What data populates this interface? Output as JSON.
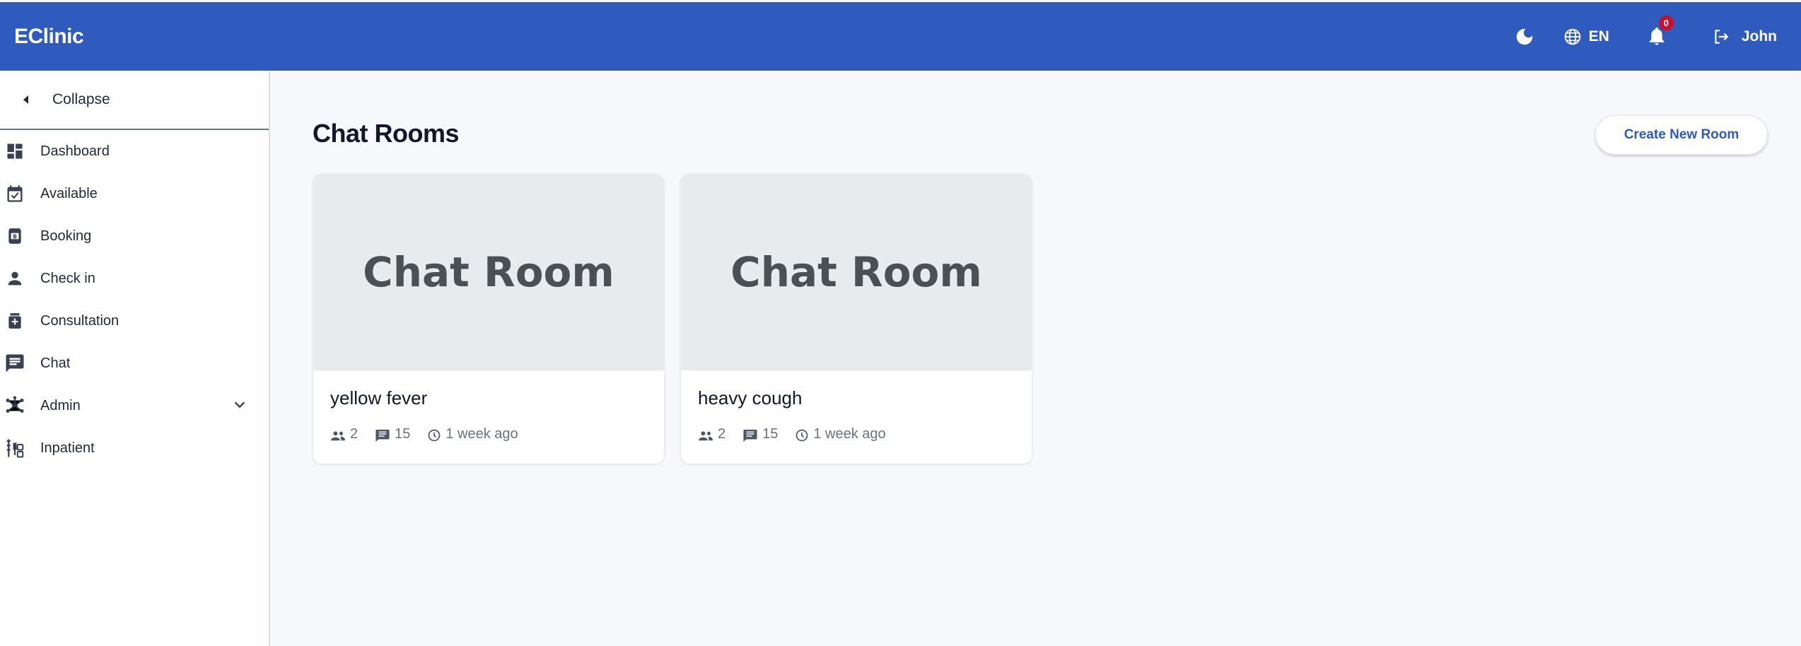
{
  "header": {
    "brand": "EClinic",
    "language": "EN",
    "notification_count": "0",
    "user_name": "John",
    "icons": [
      "moon-icon",
      "globe-icon",
      "bell-icon",
      "logout-icon"
    ]
  },
  "sidebar": {
    "collapse_label": "Collapse",
    "items": [
      {
        "label": "Dashboard",
        "icon": "dashboard-icon"
      },
      {
        "label": "Available",
        "icon": "calendar-check-icon"
      },
      {
        "label": "Booking",
        "icon": "booking-icon"
      },
      {
        "label": "Check in",
        "icon": "person-icon"
      },
      {
        "label": "Consultation",
        "icon": "medical-icon"
      },
      {
        "label": "Chat",
        "icon": "chat-icon"
      },
      {
        "label": "Admin",
        "icon": "hub-icon"
      },
      {
        "label": "Inpatient",
        "icon": "inpatient-icon"
      }
    ]
  },
  "main": {
    "title": "Chat Rooms",
    "create_button": "Create New Room",
    "rooms": [
      {
        "thumb_text": "Chat Room",
        "name": "yellow fever",
        "members": "2",
        "messages": "15",
        "time": "1 week ago"
      },
      {
        "thumb_text": "Chat Room",
        "name": "heavy cough",
        "members": "2",
        "messages": "15",
        "time": "1 week ago"
      }
    ]
  },
  "colors": {
    "header_bg": "#2f5bbf",
    "accent": "#2f5bbf",
    "badge": "#c8102e",
    "page_bg": "#f7f8fc"
  }
}
